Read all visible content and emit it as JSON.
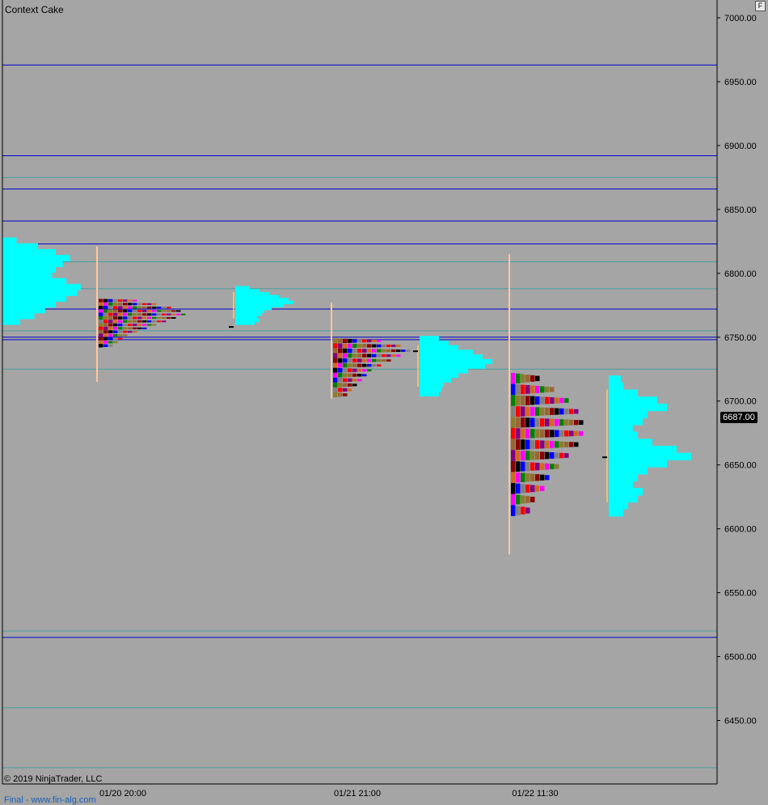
{
  "window": {
    "title": "Context Cake",
    "copyright": "© 2019 NinjaTrader, LLC",
    "footer_link": "Final - www.fin-alg.com",
    "corner_button": "F"
  },
  "colors": {
    "background": "#a5a5a5",
    "axis_line": "#000000",
    "blue_level": "#0000cc",
    "teal_level": "#4a9ea0",
    "volume_profile": "#00ffff",
    "range_line": "#ffc7a0",
    "tpo_palette": [
      "#8b0000",
      "#ff0000",
      "#008000",
      "#000000",
      "#800080",
      "#8b7d2e",
      "#0000ff",
      "#d2691e",
      "#996633",
      "#808080",
      "#ff00ff"
    ]
  },
  "chart_data": {
    "type": "market-profile",
    "title": "Context Cake",
    "ylim": [
      6410,
      7010
    ],
    "y_ticks": [
      7000,
      6950,
      6900,
      6850,
      6800,
      6750,
      6700,
      6650,
      6600,
      6550,
      6500,
      6450
    ],
    "y_tick_labels": [
      "7000.00",
      "6950.00",
      "6900.00",
      "6850.00",
      "6800.00",
      "6750.00",
      "6700.00",
      "6650.00",
      "6600.00",
      "6550.00",
      "6500.00",
      "6450.00"
    ],
    "x_labels": [
      "01/20 20:00",
      "01/21 21:00",
      "01/22 11:30"
    ],
    "last_price": 6687,
    "last_price_label": "6687.00",
    "blue_levels": [
      6963,
      6892,
      6866,
      6841,
      6823,
      6772,
      6750,
      6748,
      6515
    ],
    "teal_levels": [
      6875,
      6809,
      6788,
      6755,
      6725,
      6520,
      6460,
      6413
    ],
    "sessions": [
      {
        "label": "01/20 20:00",
        "high": 6821,
        "low": 6715,
        "tpo_high": 6780,
        "tpo_low": 6742,
        "widths": [
          8,
          12,
          15,
          17,
          18,
          16,
          14,
          12,
          10,
          8,
          6,
          5,
          4,
          3
        ],
        "profile_high": 6790,
        "profile_low": 6760,
        "profile_poc": 6758,
        "profile_lengths": [
          6,
          10,
          14,
          18,
          22,
          24,
          20,
          15,
          12,
          11,
          9,
          10,
          8
        ]
      },
      {
        "label": "01/21 21:00",
        "high": 6777,
        "low": 6702,
        "tpo_high": 6749,
        "tpo_low": 6703,
        "widths": [
          10,
          14,
          16,
          14,
          12,
          10,
          8,
          7,
          6,
          5,
          4,
          3
        ],
        "profile_high": 6751,
        "profile_low": 6704,
        "profile_poc": 6739,
        "profile_lengths": [
          8,
          12,
          16,
          22,
          26,
          30,
          27,
          20,
          16,
          13,
          10,
          9,
          8
        ]
      },
      {
        "label": "01/22 11:30",
        "high": 6815,
        "low": 6580,
        "tpo_high": 6722,
        "tpo_low": 6610,
        "widths": [
          6,
          9,
          12,
          14,
          15,
          15,
          14,
          12,
          10,
          8,
          7,
          5,
          4
        ],
        "profile_high": 6720,
        "profile_low": 6610,
        "profile_poc": 6656,
        "profile_lengths": [
          5,
          6,
          12,
          20,
          24,
          16,
          14,
          10,
          12,
          18,
          28,
          34,
          24,
          16,
          12,
          10,
          14,
          12,
          8,
          6
        ]
      }
    ],
    "left_profile": {
      "high": 6828,
      "low": 6760,
      "profile_lengths": [
        8,
        20,
        30,
        38,
        34,
        30,
        28,
        36,
        44,
        42,
        36,
        30,
        24,
        18,
        10
      ]
    }
  }
}
